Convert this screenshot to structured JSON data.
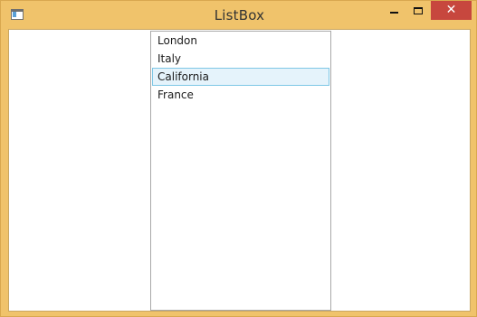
{
  "window": {
    "title": "ListBox"
  },
  "controls": {
    "minimize_icon": "minimize-icon",
    "maximize_icon": "maximize-icon",
    "close_icon": "close-icon",
    "close_glyph": "✕"
  },
  "listbox": {
    "items": [
      {
        "label": "London",
        "selected": false
      },
      {
        "label": "Italy",
        "selected": false
      },
      {
        "label": "California",
        "selected": true
      },
      {
        "label": "France",
        "selected": false
      }
    ]
  },
  "colors": {
    "frame": "#f0c36b",
    "close_button": "#c7473e",
    "selection_bg": "#e5f3fb",
    "selection_border": "#7ec7e6"
  }
}
